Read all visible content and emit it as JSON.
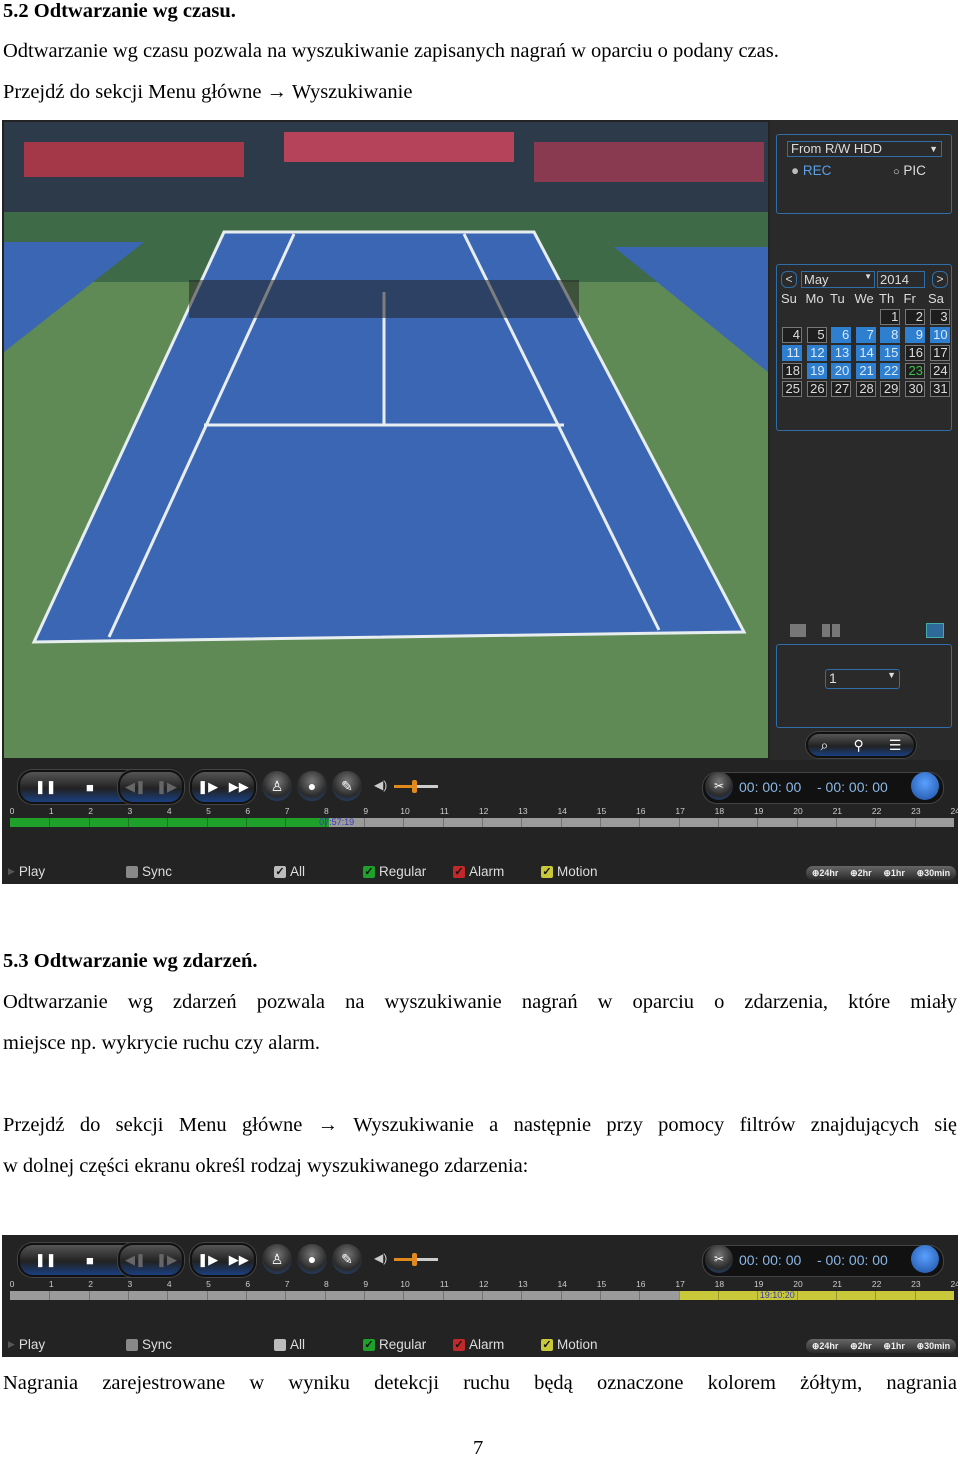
{
  "section52": {
    "heading": "5.2 Odtwarzanie wg czasu.",
    "line1": "Odtwarzanie wg czasu pozwala na wyszukiwanie zapisanych nagrań w oparciu o podany czas.",
    "line2": "Przejdź do sekcji Menu główne → Wyszukiwanie"
  },
  "dvr": {
    "source": "From R/W HDD",
    "rec": "REC",
    "pic": "PIC",
    "month": "May",
    "year": "2014",
    "prev": "<",
    "next": ">",
    "weekdays": [
      "Su",
      "Mo",
      "Tu",
      "We",
      "Th",
      "Fr",
      "Sa"
    ],
    "first_weekday": 4,
    "days_in_month": 31,
    "recorded_days": [
      6,
      7,
      8,
      9,
      10,
      11,
      12,
      13,
      14,
      15,
      19,
      20,
      21,
      22
    ],
    "today": 23,
    "channel": "1",
    "colors": {
      "accent": "#2f7fd0",
      "regular": "#1fa02a",
      "motion": "#c8c83a",
      "alarm": "#c0282a"
    }
  },
  "controls": [
    {
      "time_start": "00: 00: 00",
      "time_end": "- 00: 00: 00",
      "hours": [
        "0",
        "1",
        "2",
        "3",
        "4",
        "5",
        "6",
        "7",
        "8",
        "9",
        "10",
        "11",
        "12",
        "13",
        "14",
        "15",
        "16",
        "17",
        "18",
        "19",
        "20",
        "21",
        "22",
        "23",
        "24"
      ],
      "segments": [
        {
          "from": 0,
          "to": 8.1,
          "color": "#1fa02a"
        }
      ],
      "cursor_time": "07:57:19",
      "cursor_hour": 8.1,
      "play": "Play",
      "sync": "Sync",
      "all": "All",
      "regular": "Regular",
      "alarm": "Alarm",
      "motion": "Motion",
      "checks": {
        "sync": false,
        "all": true,
        "regular": true,
        "alarm": true,
        "motion": true
      },
      "zoom": [
        "24hr",
        "2hr",
        "1hr",
        "30min"
      ]
    },
    {
      "time_start": "00: 00: 00",
      "time_end": "- 00: 00: 00",
      "hours": [
        "0",
        "1",
        "2",
        "3",
        "4",
        "5",
        "6",
        "7",
        "8",
        "9",
        "10",
        "11",
        "12",
        "13",
        "14",
        "15",
        "16",
        "17",
        "18",
        "19",
        "20",
        "21",
        "22",
        "23",
        "24"
      ],
      "segments": [
        {
          "from": 17,
          "to": 24,
          "color": "#c8c83a"
        }
      ],
      "cursor_time": "19:10:20",
      "cursor_hour": 19.3,
      "play": "Play",
      "sync": "Sync",
      "all": "All",
      "regular": "Regular",
      "alarm": "Alarm",
      "motion": "Motion",
      "checks": {
        "sync": false,
        "all": false,
        "regular": true,
        "alarm": true,
        "motion": true
      },
      "zoom": [
        "24hr",
        "2hr",
        "1hr",
        "30min"
      ]
    }
  ],
  "section53": {
    "heading": "5.3 Odtwarzanie wg zdarzeń.",
    "p1a": "Odtwarzanie wg zdarzeń pozwala na wyszukiwanie nagrań w oparciu o zdarzenia, które miały",
    "p1b": "miejsce np. wykrycie ruchu czy alarm.",
    "p2a": "Przejdź do sekcji Menu główne → Wyszukiwanie a następnie przy pomocy filtrów znajdujących się",
    "p2b": "w dolnej części ekranu określ rodzaj wyszukiwanego zdarzenia:",
    "p3": "Nagrania zarejestrowane w wyniku detekcji ruchu będą oznaczone kolorem żółtym, nagrania"
  },
  "page_number": "7"
}
